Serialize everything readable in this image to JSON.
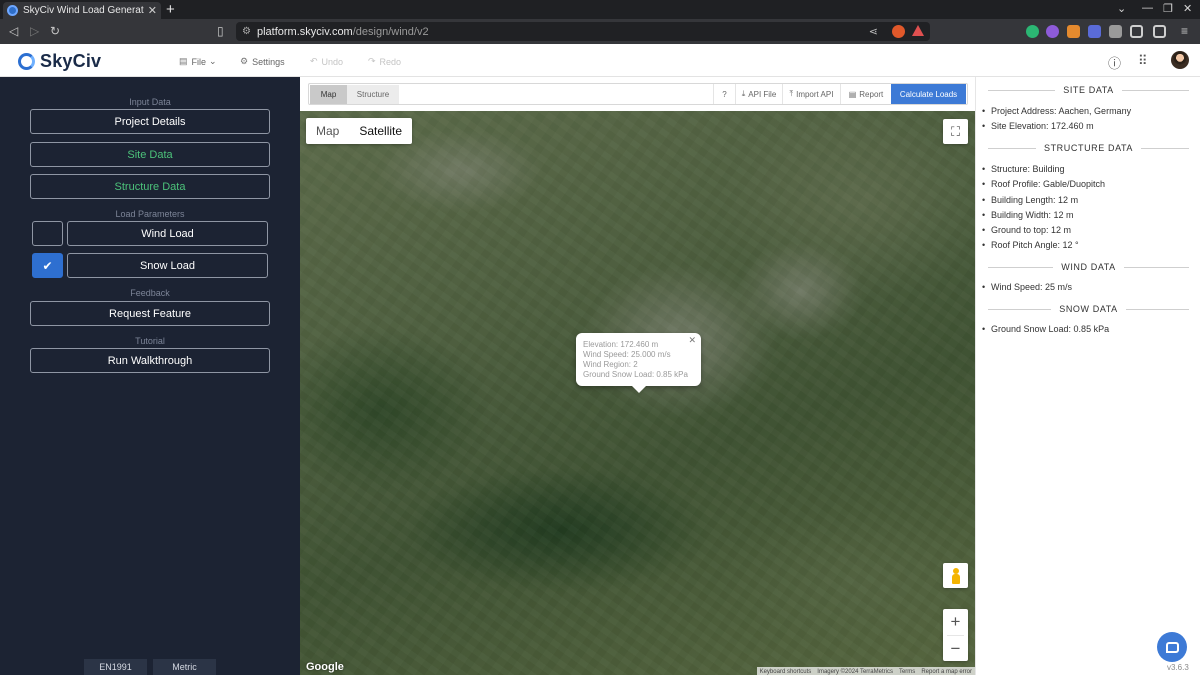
{
  "browser": {
    "tab_title": "SkyCiv Wind Load Generat",
    "url_host": "platform.skyciv.com",
    "url_path": "/design/wind/v2"
  },
  "app": {
    "logo": "SkyCiv",
    "menu": [
      {
        "label": "File",
        "icon": "file-icon"
      },
      {
        "label": "Settings",
        "icon": "gear-icon"
      },
      {
        "label": "Undo",
        "icon": "undo-icon"
      },
      {
        "label": "Redo",
        "icon": "redo-icon"
      }
    ]
  },
  "sidebar": {
    "input_data_label": "Input Data",
    "project_details": "Project Details",
    "site_data": "Site Data",
    "structure_data": "Structure Data",
    "load_params_label": "Load Parameters",
    "wind_load": "Wind Load",
    "wind_load_checked": false,
    "snow_load": "Snow Load",
    "snow_load_checked": true,
    "feedback_label": "Feedback",
    "request_feature": "Request Feature",
    "tutorial_label": "Tutorial",
    "run_walkthrough": "Run Walkthrough",
    "footer_code": "EN1991",
    "footer_units": "Metric"
  },
  "toolbar": {
    "tab_map": "Map",
    "tab_structure": "Structure",
    "help": "?",
    "api_file": "API File",
    "import_api": "Import API",
    "report": "Report",
    "calculate": "Calculate Loads"
  },
  "map": {
    "type_map": "Map",
    "type_satellite": "Satellite",
    "google": "Google",
    "attribution": [
      "Keyboard shortcuts",
      "Imagery ©2024 TerraMetrics",
      "Terms",
      "Report a map error"
    ],
    "infowindow": {
      "elevation": "Elevation: 172.460 m",
      "wind_speed": "Wind Speed: 25.000 m/s",
      "wind_region": "Wind Region: 2",
      "snow_load": "Ground Snow Load: 0.85 kPa"
    }
  },
  "panel": {
    "site_heading": "SITE DATA",
    "site_items": [
      "Project Address: Aachen, Germany",
      "Site Elevation: 172.460 m"
    ],
    "structure_heading": "STRUCTURE DATA",
    "structure_items": [
      "Structure: Building",
      "Roof Profile: Gable/Duopitch",
      "Building Length: 12 m",
      "Building Width: 12 m",
      "Ground to top: 12 m",
      "Roof Pitch Angle: 12 °"
    ],
    "wind_heading": "WIND DATA",
    "wind_items": [
      "Wind Speed: 25 m/s"
    ],
    "snow_heading": "SNOW DATA",
    "snow_items": [
      "Ground Snow Load: 0.85 kPa"
    ],
    "version": "v3.6.3"
  }
}
